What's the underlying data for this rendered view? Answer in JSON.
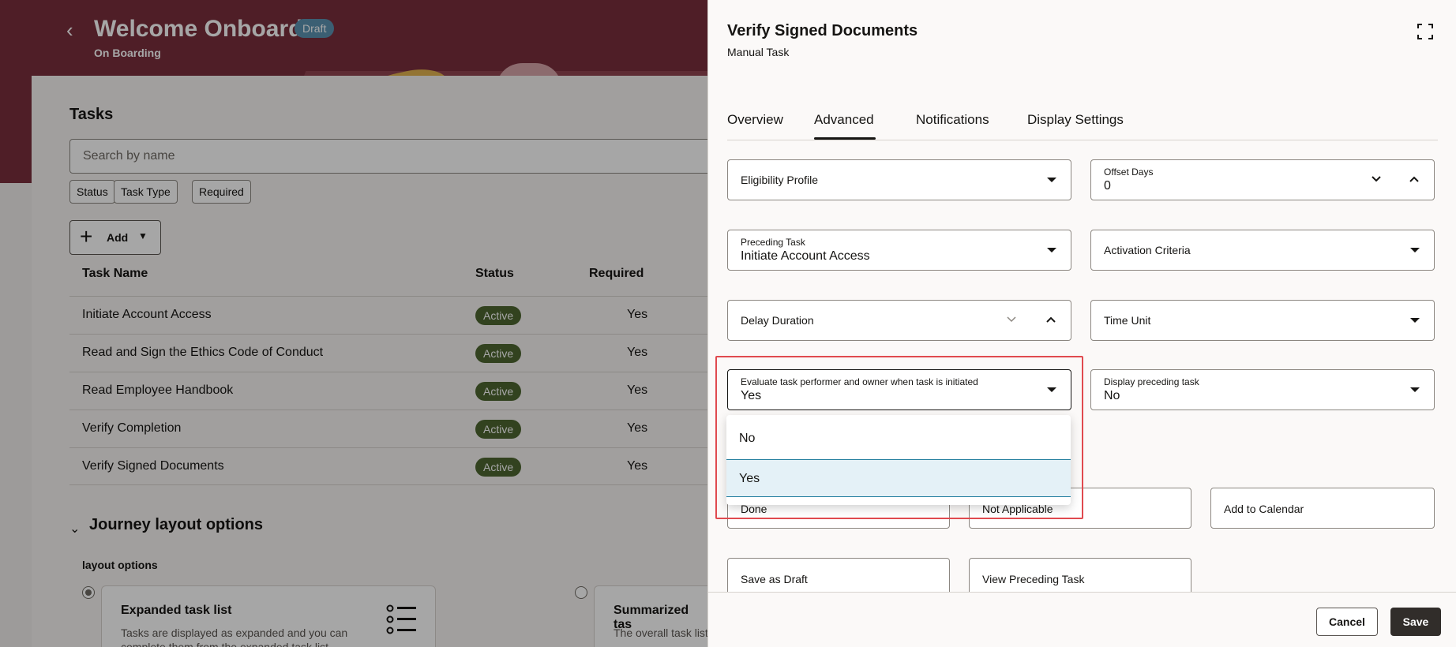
{
  "header": {
    "title": "Welcome Onboard",
    "badge": "Draft",
    "subtitle": "On Boarding"
  },
  "tasks": {
    "heading": "Tasks",
    "search_placeholder": "Search by name",
    "filters": [
      "Status",
      "Task Type",
      "Required"
    ],
    "add_label": "Add",
    "columns": [
      "Task Name",
      "Status",
      "Required"
    ],
    "rows": [
      {
        "name": "Initiate Account Access",
        "status": "Active",
        "required": "Yes"
      },
      {
        "name": "Read and Sign the Ethics Code of Conduct",
        "status": "Active",
        "required": "Yes"
      },
      {
        "name": "Read Employee Handbook",
        "status": "Active",
        "required": "Yes"
      },
      {
        "name": "Verify Completion",
        "status": "Active",
        "required": "Yes"
      },
      {
        "name": "Verify Signed Documents",
        "status": "Active",
        "required": "Yes"
      }
    ]
  },
  "journey": {
    "heading": "Journey layout options",
    "layout_label": "layout options",
    "options": [
      {
        "title": "Expanded task list",
        "desc": "Tasks are displayed as expanded and you can complete them from the expanded task list."
      },
      {
        "title": "Summarized tas",
        "desc": "The overall task list and the details of"
      }
    ]
  },
  "drawer": {
    "title": "Verify Signed Documents",
    "subtitle": "Manual Task",
    "tabs": [
      "Overview",
      "Advanced",
      "Notifications",
      "Display Settings"
    ],
    "active_tab": "Advanced",
    "fields": {
      "eligibility_profile": {
        "label": "Eligibility Profile"
      },
      "offset_days": {
        "label": "Offset Days",
        "value": "0"
      },
      "preceding_task": {
        "label": "Preceding Task",
        "value": "Initiate Account Access"
      },
      "activation_criteria": {
        "label": "Activation Criteria"
      },
      "delay_duration": {
        "label": "Delay Duration"
      },
      "time_unit": {
        "label": "Time Unit"
      },
      "evaluate_performer": {
        "label": "Evaluate task performer and owner when task is initiated",
        "value": "Yes"
      },
      "display_preceding": {
        "label": "Display preceding task",
        "value": "No"
      }
    },
    "dropdown_options": [
      "No",
      "Yes"
    ],
    "dropdown_selected": "Yes",
    "action_fields": [
      "Done",
      "Not Applicable",
      "Add to Calendar",
      "Save as Draft",
      "View Preceding Task"
    ],
    "footer": {
      "cancel": "Cancel",
      "save": "Save"
    }
  },
  "colors": {
    "hero": "#7a2e3d",
    "badge": "#5b92b1",
    "active_badge": "#4d6630",
    "highlight": "#e04a4f",
    "selected_option": "#e4f1f7",
    "save_button": "#312d2a"
  }
}
